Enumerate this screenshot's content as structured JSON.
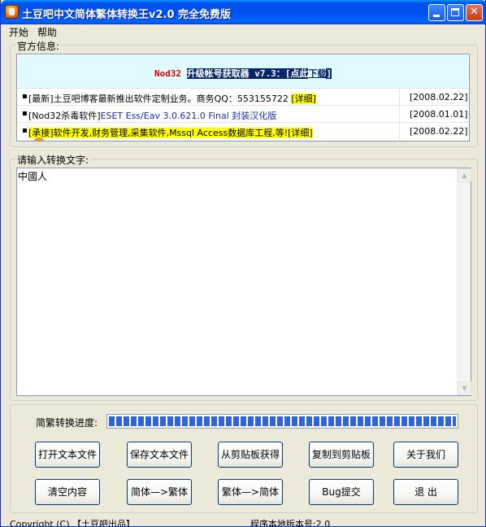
{
  "window": {
    "title": "土豆吧中文简体繁体转换王v2.0  完全免费版"
  },
  "menu": {
    "items": [
      "开始",
      "帮助"
    ]
  },
  "official_info": {
    "legend": "官方信息:",
    "banner": {
      "nod": "Nod32",
      "text": "升级帐号获取器 v7.3：",
      "link_prefix": "[点此",
      "link_text": "下载",
      "link_suffix": "]"
    },
    "news": [
      {
        "bullet": "▪",
        "prefix": "[最新]土豆吧博客最新推出软件定制业务。商务QQ：553155722 ",
        "link": "[详细]",
        "date": "[2008.02.22]"
      },
      {
        "bullet": "▪",
        "prefix": "[Nod32杀毒软件]",
        "link": "ESET Ess/Eav 3.0.621.0 Final 封装汉化版",
        "date": "[2008.01.01]"
      },
      {
        "bullet": "▪",
        "prefix": "[承接]软件开发,财务管理,采集软件,Mssql Access数据库工程,等!",
        "link": "[详细]",
        "date": "[2008.02.22]"
      }
    ]
  },
  "input": {
    "legend": "请输入转换文字:",
    "value": "中國人"
  },
  "progress": {
    "label": "简繁转换进度:",
    "percent": 100
  },
  "buttons": {
    "open_file": "打开文本文件",
    "save_file": "保存文本文件",
    "from_clipboard": "从剪贴板获得",
    "to_clipboard": "复制到剪贴板",
    "about": "关于我们",
    "clear": "清空内容",
    "simp_to_trad": "简体—>繁体",
    "trad_to_simp": "繁体—>简体",
    "bug_report": "Bug提交",
    "exit": "退  出"
  },
  "status": {
    "copyright": "Copyright (C) 【土豆吧出品】",
    "version": "程序本地版本号:2.0"
  },
  "colors": {
    "titlebar": "#0053EE",
    "window_bg": "#ECE9D8",
    "banner_bg": "#E0FBFF",
    "highlight_yellow": "#FFFF00",
    "progress": "#2F64D8"
  }
}
